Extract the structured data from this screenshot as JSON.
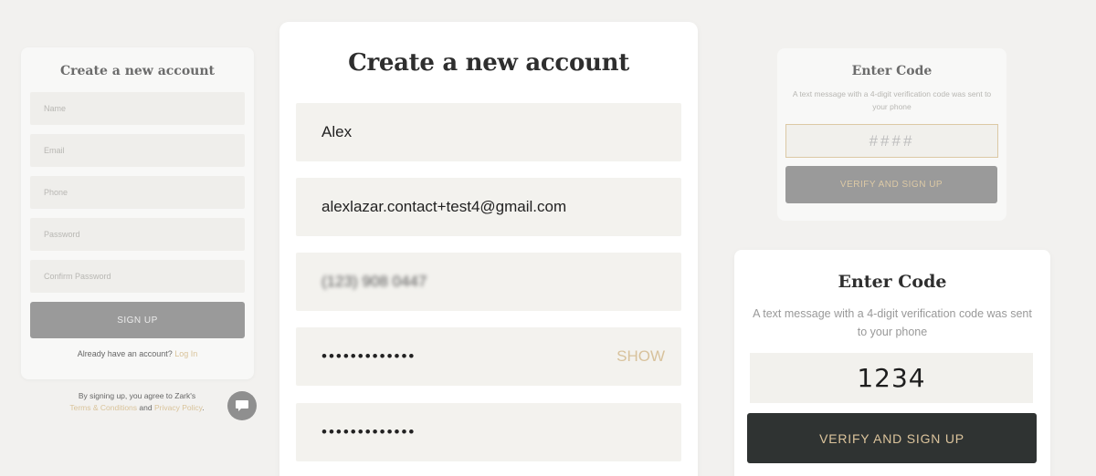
{
  "signup_small": {
    "title": "Create a new account",
    "fields": {
      "name_placeholder": "Name",
      "email_placeholder": "Email",
      "phone_placeholder": "Phone",
      "password_placeholder": "Password",
      "confirm_placeholder": "Confirm Password"
    },
    "signup_button": "SIGN UP",
    "login_prompt": "Already have an account?",
    "login_link": "Log In",
    "terms_prefix": "By signing up, you agree to Zark's",
    "terms_link": "Terms & Conditions",
    "terms_and": "and",
    "privacy_link": "Privacy Policy",
    "terms_suffix": "."
  },
  "signup_large": {
    "title": "Create a new account",
    "name_value": "Alex",
    "email_value": "alexlazar.contact+test4@gmail.com",
    "phone_value": "(123) 908 0447",
    "password_value": "•••••••••••••",
    "confirm_value": "•••••••••••••",
    "show_label": "SHOW"
  },
  "code_small": {
    "title": "Enter Code",
    "description": "A text message with a 4-digit verification code was sent to your phone",
    "code_placeholder": "####",
    "verify_button": "VERIFY AND SIGN UP"
  },
  "code_large": {
    "title": "Enter Code",
    "description": "A text message with a 4-digit verification code was sent to your phone",
    "code_value": "1234",
    "verify_button": "VERIFY AND SIGN UP"
  },
  "colors": {
    "background": "#f2f1ef",
    "accent_gold": "#d9c39a",
    "button_gray": "#9a9a9a",
    "button_dark": "#2f3332"
  },
  "icons": {
    "chat": "chat-bubble-icon"
  }
}
